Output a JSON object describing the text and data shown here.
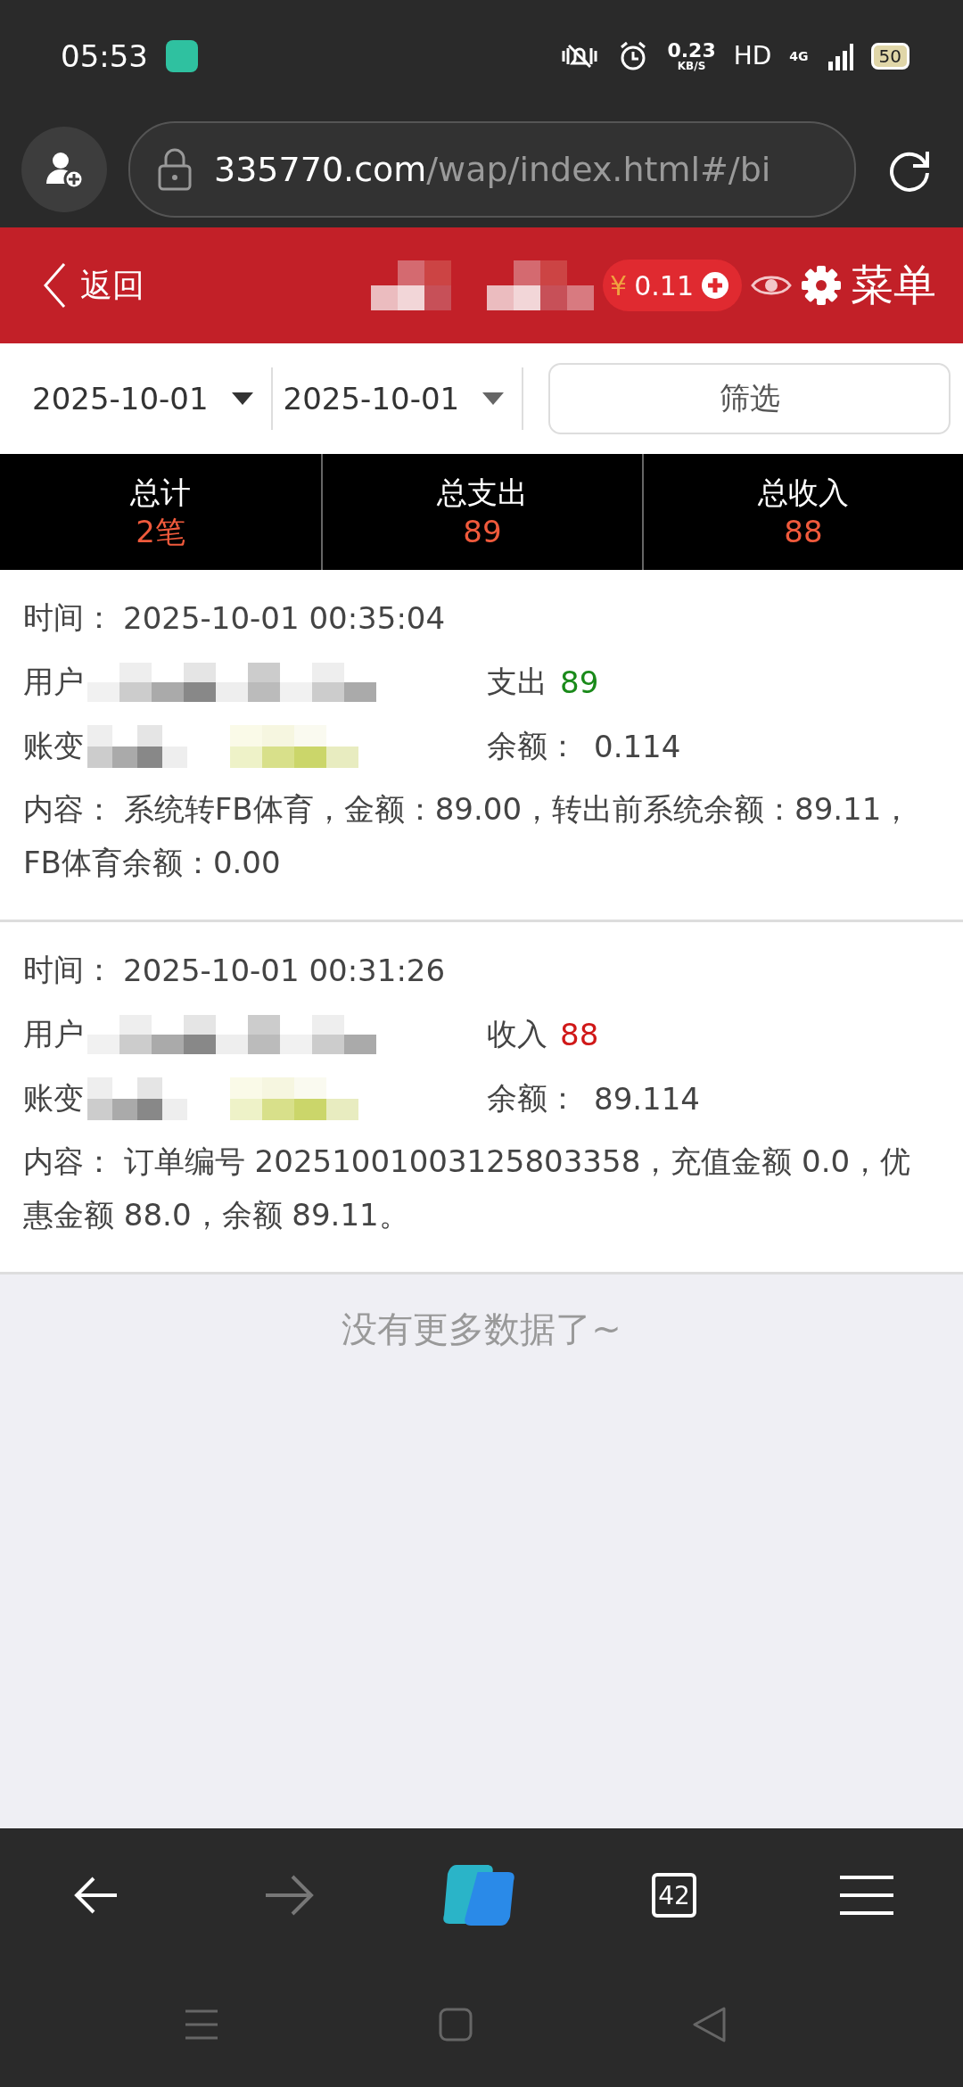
{
  "status_bar": {
    "time": "05:53",
    "network_speed": "0.23",
    "speed_unit": "KB/S",
    "hd": "HD",
    "network_type": "4G",
    "battery": "50"
  },
  "address_bar": {
    "domain": "335770.com",
    "path": "/wap/index.html#/bi"
  },
  "header": {
    "back": "返回",
    "currency": "¥",
    "balance": "0.11",
    "menu": "菜单"
  },
  "filter": {
    "start_date": "2025-10-01",
    "end_date": "2025-10-01",
    "button": "筛选"
  },
  "summary": [
    {
      "label": "总计",
      "value": "2笔"
    },
    {
      "label": "总支出",
      "value": "89"
    },
    {
      "label": "总收入",
      "value": "88"
    }
  ],
  "records": [
    {
      "time_label": "时间：",
      "time": "2025-10-01 00:35:04",
      "user_label": "用户",
      "kind": "expense",
      "amount_label": "支出",
      "amount": "89",
      "change_label": "账变",
      "balance_label": "余额：",
      "balance": "0.114",
      "content_label": "内容：",
      "content": "系统转FB体育，金额：89.00，转出前系统余额：89.11，FB体育余额：0.00"
    },
    {
      "time_label": "时间：",
      "time": "2025-10-01 00:31:26",
      "user_label": "用户",
      "kind": "income",
      "amount_label": "收入",
      "amount": "88",
      "change_label": "账变",
      "balance_label": "余额：",
      "balance": "89.114",
      "content_label": "内容：",
      "content": "订单编号 20251001003125803358，充值金额 0.0，优惠金额 88.0，余额 89.11。"
    }
  ],
  "footer": "没有更多数据了~",
  "browser_toolbar": {
    "tab_count": "42"
  }
}
